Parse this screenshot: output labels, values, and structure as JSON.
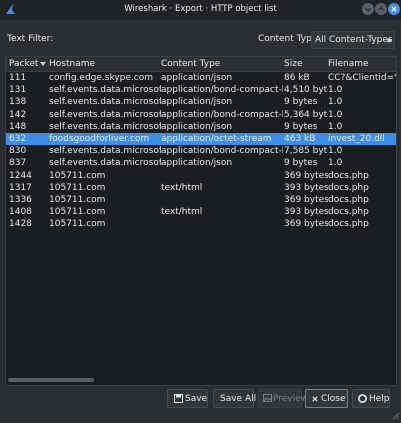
{
  "window": {
    "title": "Wireshark · Export · HTTP object list"
  },
  "filter": {
    "text_label": "Text Filter:",
    "text_value": "",
    "content_type_label": "Content Type:",
    "content_type_value": "All Content-Types"
  },
  "table": {
    "columns": [
      "Packet",
      "Hostname",
      "Content Type",
      "Size",
      "Filename"
    ],
    "sort_column": "Packet",
    "rows": [
      {
        "packet": "111",
        "hostname": "config.edge.skype.com",
        "content_type": "application/json",
        "size": "86 kB",
        "filename": "CC?&Clientid=%7E"
      },
      {
        "packet": "131",
        "hostname": "self.events.data.microsoft.com",
        "content_type": "application/bond-compact-binary",
        "size": "4,510 bytes",
        "filename": "1.0"
      },
      {
        "packet": "138",
        "hostname": "self.events.data.microsoft.com",
        "content_type": "application/json",
        "size": "9 bytes",
        "filename": "1.0"
      },
      {
        "packet": "142",
        "hostname": "self.events.data.microsoft.com",
        "content_type": "application/bond-compact-binary",
        "size": "5,364 bytes",
        "filename": "1.0"
      },
      {
        "packet": "148",
        "hostname": "self.events.data.microsoft.com",
        "content_type": "application/json",
        "size": "9 bytes",
        "filename": "1.0"
      },
      {
        "packet": "632",
        "hostname": "foodsgoodforliver.com",
        "content_type": "application/octet-stream",
        "size": "463 kB",
        "filename": "invest_20.dll",
        "selected": true
      },
      {
        "packet": "830",
        "hostname": "self.events.data.microsoft.com",
        "content_type": "application/bond-compact-binary",
        "size": "7,585 bytes",
        "filename": "1.0"
      },
      {
        "packet": "837",
        "hostname": "self.events.data.microsoft.com",
        "content_type": "application/json",
        "size": "9 bytes",
        "filename": "1.0"
      },
      {
        "packet": "1244",
        "hostname": "105711.com",
        "content_type": "",
        "size": "369 bytes",
        "filename": "docs.php"
      },
      {
        "packet": "1317",
        "hostname": "105711.com",
        "content_type": "text/html",
        "size": "393 bytes",
        "filename": "docs.php"
      },
      {
        "packet": "1336",
        "hostname": "105711.com",
        "content_type": "",
        "size": "369 bytes",
        "filename": "docs.php"
      },
      {
        "packet": "1408",
        "hostname": "105711.com",
        "content_type": "text/html",
        "size": "393 bytes",
        "filename": "docs.php"
      },
      {
        "packet": "1428",
        "hostname": "105711.com",
        "content_type": "",
        "size": "369 bytes",
        "filename": "docs.php"
      }
    ]
  },
  "buttons": {
    "save": "Save",
    "save_all": "Save All",
    "preview": "Preview",
    "close": "Close",
    "help": "Help"
  },
  "colors": {
    "accent": "#3d8fe6",
    "background": "#2a2e32",
    "table_background": "#1b1e20"
  },
  "icons": {
    "app": "wireshark-fin-icon",
    "save": "floppy-disk-icon",
    "preview": "image-icon",
    "close": "x-icon",
    "help": "help-lifebuoy-icon"
  }
}
